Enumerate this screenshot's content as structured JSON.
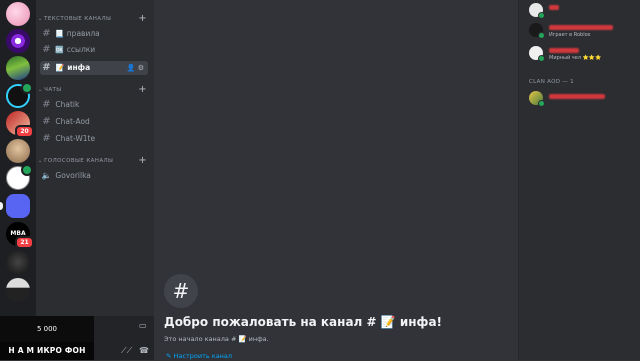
{
  "sidebar": {
    "categories": {
      "text": "ТЕКСТОВЫЕ КАНАЛЫ",
      "chats": "ЧАТЫ",
      "voice": "ГОЛОСОВЫЕ КАНАЛЫ"
    },
    "text_channels": [
      {
        "emoji": "📃",
        "label": "правила"
      },
      {
        "emoji": "🆗",
        "label": "ссылки"
      },
      {
        "emoji": "📝",
        "label": "инфа",
        "active": true
      }
    ],
    "chat_channels": [
      {
        "label": "Chatik"
      },
      {
        "label": "Chat-Aod"
      },
      {
        "label": "Chat-W1te"
      }
    ],
    "voice_channels": [
      {
        "label": "Govorilka"
      }
    ]
  },
  "servers": {
    "badges": [
      "20",
      "21"
    ],
    "icon_text_kick": "MBA"
  },
  "overlay": {
    "coins": "5 000",
    "mic_banner": "Н А М ИКРО ФОН"
  },
  "main": {
    "welcome_title": "Добро пожаловать на канал # 📝 инфа!",
    "welcome_sub": "Это начало канала # 📝 инфа.",
    "setup_link": "Настроить канал"
  },
  "members": {
    "group_clan": "CLAN AOD — 1",
    "list": [
      {
        "status": ""
      },
      {
        "status": "Играет в Roblox"
      },
      {
        "status": "Мирный чел ⭐⭐⭐"
      }
    ]
  },
  "colors": {
    "accent_red": "#d0383c",
    "online": "#23a55a",
    "badge": "#f23f43",
    "link": "#00a8fc"
  }
}
